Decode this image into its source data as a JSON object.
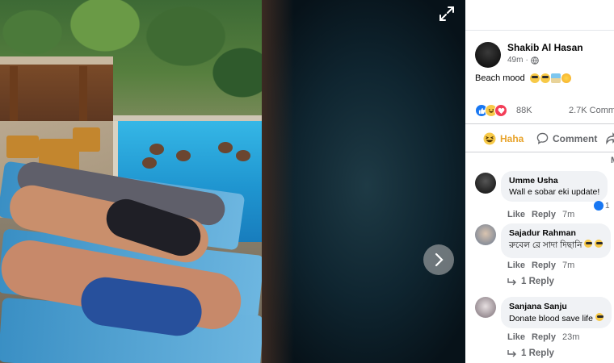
{
  "post": {
    "author": "Shakib Al Hasan",
    "time": "49m",
    "text": "Beach mood",
    "reaction_count": "88K",
    "comment_count": "2.7K Comm",
    "actions": {
      "haha_label": "Haha",
      "comment_label": "Comment"
    },
    "reaction_icons": [
      "like-icon",
      "haha-icon",
      "love-icon"
    ]
  },
  "comments": [
    {
      "name": "Umme Usha",
      "text": "Wall e sobar eki update!",
      "like": "Like",
      "reply": "Reply",
      "time": "7m",
      "reaction_count": "1"
    },
    {
      "name": "Sajadur Rahman",
      "text": "রুবেল রে সাদা দিছানি",
      "like": "Like",
      "reply": "Reply",
      "time": "7m",
      "replies": "1 Reply"
    },
    {
      "name": "Sanjana Sanju",
      "text": "Donate blood save life",
      "like": "Like",
      "reply": "Reply",
      "time": "23m",
      "replies": "1 Reply"
    }
  ],
  "viewer": {
    "expand_icon": "expand-icon",
    "next_icon": "chevron-right-icon"
  },
  "colors": {
    "haha": "#e8a32a",
    "like_blue": "#1877f2",
    "love_red": "#f33e58",
    "muted": "#65676b"
  },
  "sort_fragment": "M"
}
